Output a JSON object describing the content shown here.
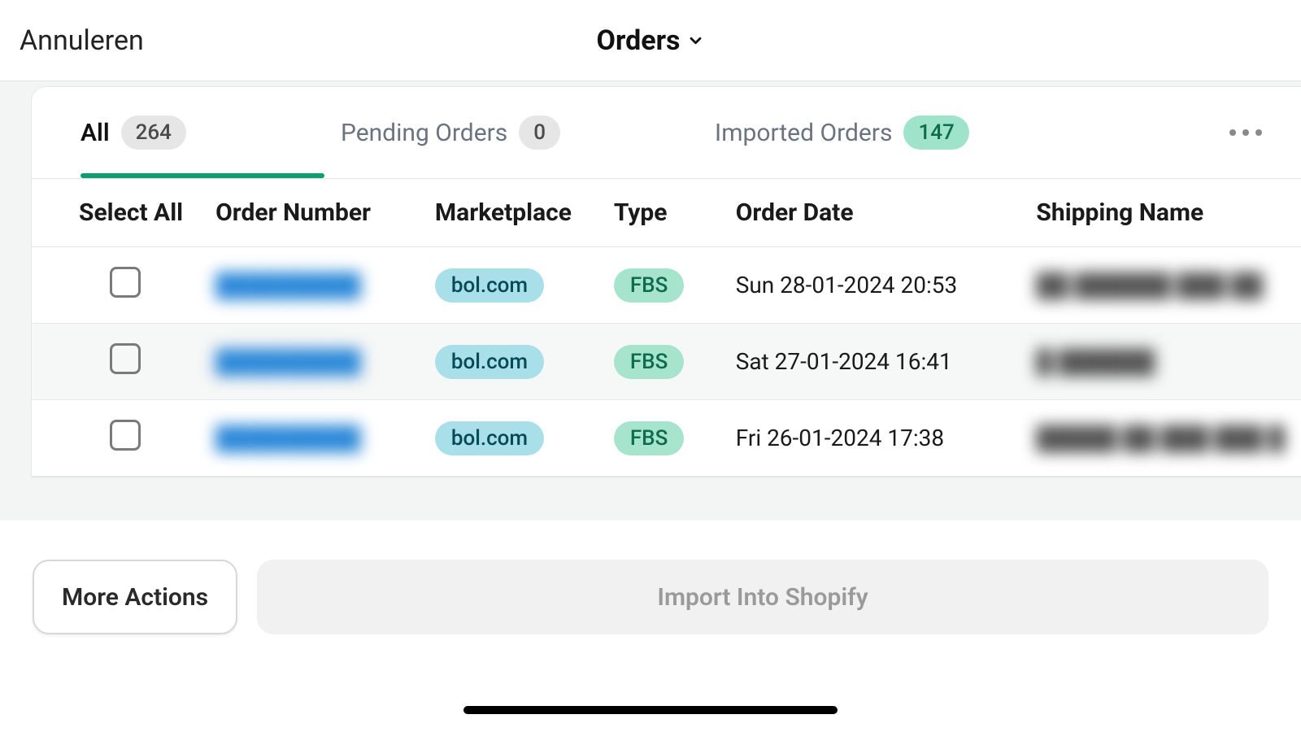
{
  "topbar": {
    "cancel": "Annuleren",
    "title": "Orders"
  },
  "tabs": {
    "all": {
      "label": "All",
      "count": "264"
    },
    "pending": {
      "label": "Pending Orders",
      "count": "0"
    },
    "imported": {
      "label": "Imported Orders",
      "count": "147"
    }
  },
  "columns": {
    "select": "Select All",
    "order": "Order Number",
    "market": "Marketplace",
    "type": "Type",
    "date": "Order Date",
    "ship": "Shipping Name"
  },
  "rows": [
    {
      "order": "█████████",
      "market": "bol.com",
      "type": "FBS",
      "date": "Sun 28-01-2024 20:53",
      "ship": "██ ██████ ███ ██"
    },
    {
      "order": "█████████",
      "market": "bol.com",
      "type": "FBS",
      "date": "Sat 27-01-2024 16:41",
      "ship": "█ ██████"
    },
    {
      "order": "█████████",
      "market": "bol.com",
      "type": "FBS",
      "date": "Fri 26-01-2024 17:38",
      "ship": "█████ ██ ███ ███ █"
    }
  ],
  "footer": {
    "more": "More Actions",
    "import": "Import Into Shopify"
  }
}
